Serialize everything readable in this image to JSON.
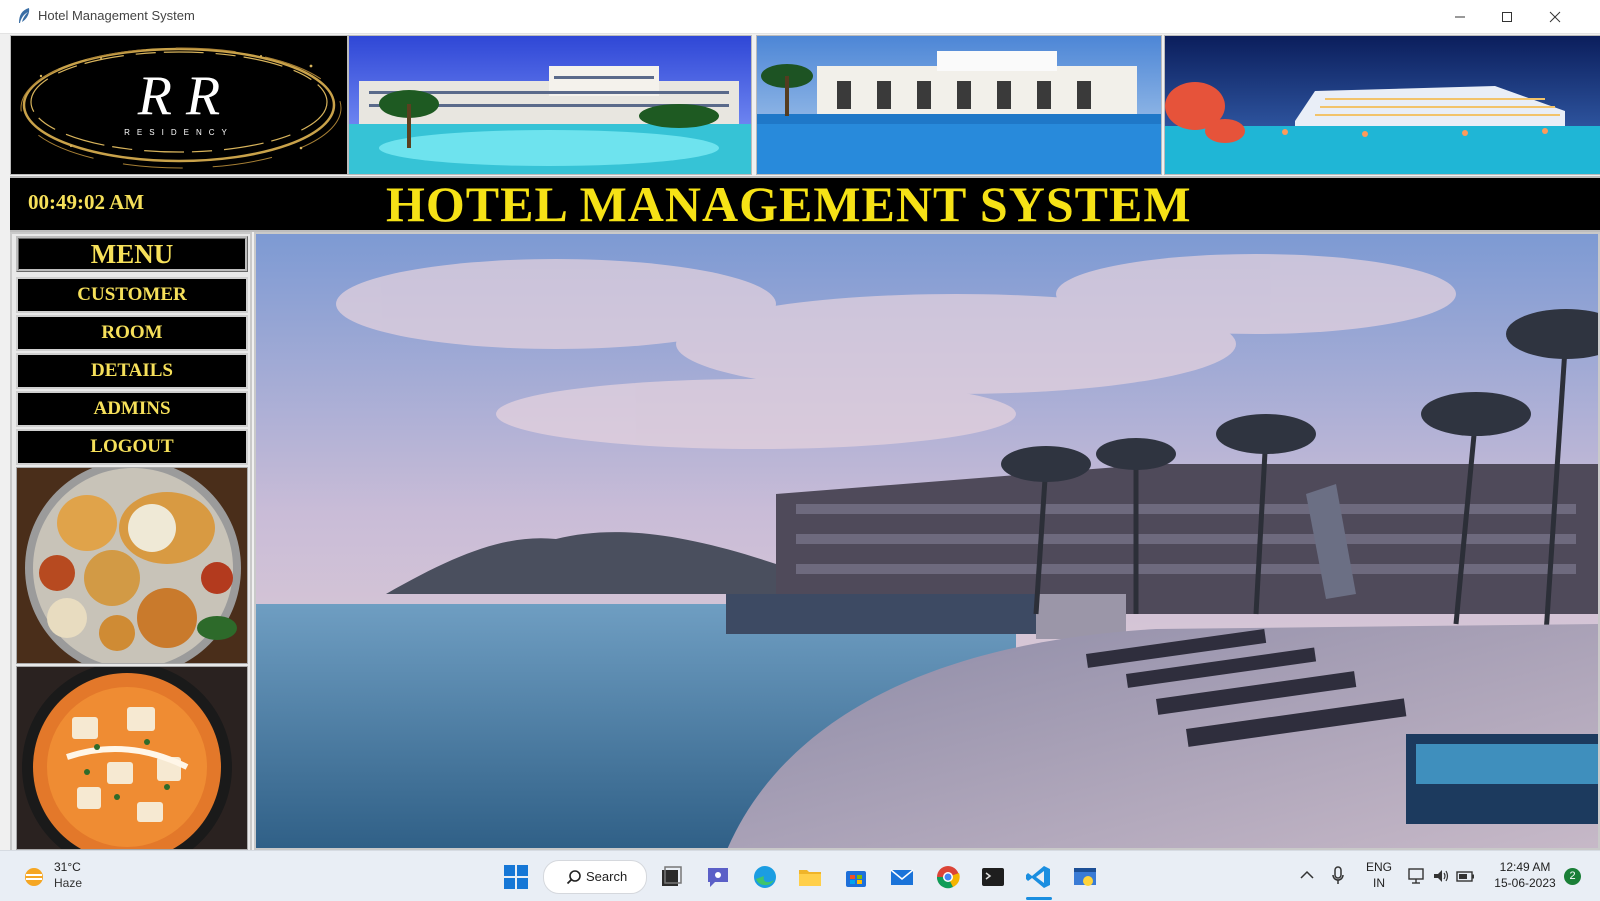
{
  "window": {
    "title": "Hotel Management System"
  },
  "header": {
    "logo_text": "R R",
    "logo_subtext": "RESIDENCY",
    "clock": "00:49:02 AM",
    "title": "HOTEL MANAGEMENT SYSTEM"
  },
  "menu": {
    "heading": "MENU",
    "items": [
      {
        "label": "CUSTOMER"
      },
      {
        "label": "ROOM"
      },
      {
        "label": "DETAILS"
      },
      {
        "label": "ADMINS"
      },
      {
        "label": "LOGOUT"
      }
    ]
  },
  "taskbar": {
    "weather_temp": "31°C",
    "weather_desc": "Haze",
    "search_label": "Search",
    "lang_top": "ENG",
    "lang_bottom": "IN",
    "time": "12:49 AM",
    "date": "15-06-2023",
    "notification_count": "2"
  },
  "colors": {
    "accent_yellow": "#f6e216",
    "menu_bg": "#000000",
    "taskbar_bg": "#e9eef5"
  }
}
